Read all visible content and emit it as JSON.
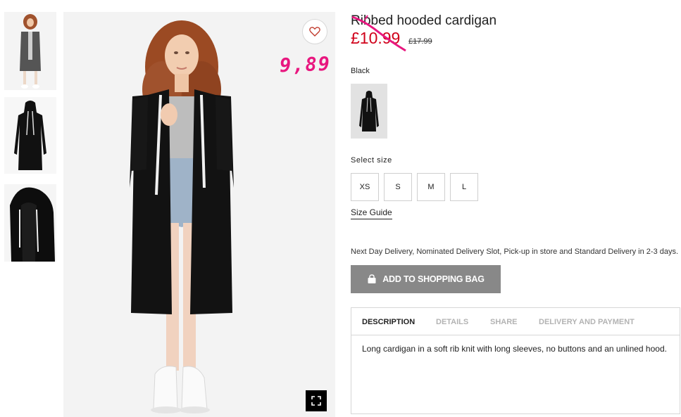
{
  "product": {
    "title": "Ribbed hooded cardigan",
    "price_current": "£10.99",
    "price_old": "£17.99",
    "handwritten_price": "9,89",
    "color_name": "Black"
  },
  "size_selector": {
    "label": "Select size",
    "sizes": [
      "XS",
      "S",
      "M",
      "L"
    ],
    "guide_label": "Size Guide"
  },
  "delivery": {
    "text": "Next Day Delivery, Nominated Delivery Slot, Pick-up in store and Standard Delivery in 2-3 days."
  },
  "cart": {
    "add_label": "ADD TO SHOPPING BAG",
    "icon": "shopping-bag-icon"
  },
  "tabs": [
    {
      "label": "DESCRIPTION",
      "active": true
    },
    {
      "label": "DETAILS",
      "active": false
    },
    {
      "label": "SHARE",
      "active": false
    },
    {
      "label": "DELIVERY AND PAYMENT",
      "active": false
    }
  ],
  "description": "Long cardigan in a soft rib knit with long sleeves, no buttons and an unlined hood.",
  "icons": {
    "favorite": "heart-icon",
    "expand": "expand-icon"
  },
  "colors": {
    "sale_red": "#d0021b",
    "annotation_pink": "#e8177f",
    "button_grey": "#888888"
  }
}
